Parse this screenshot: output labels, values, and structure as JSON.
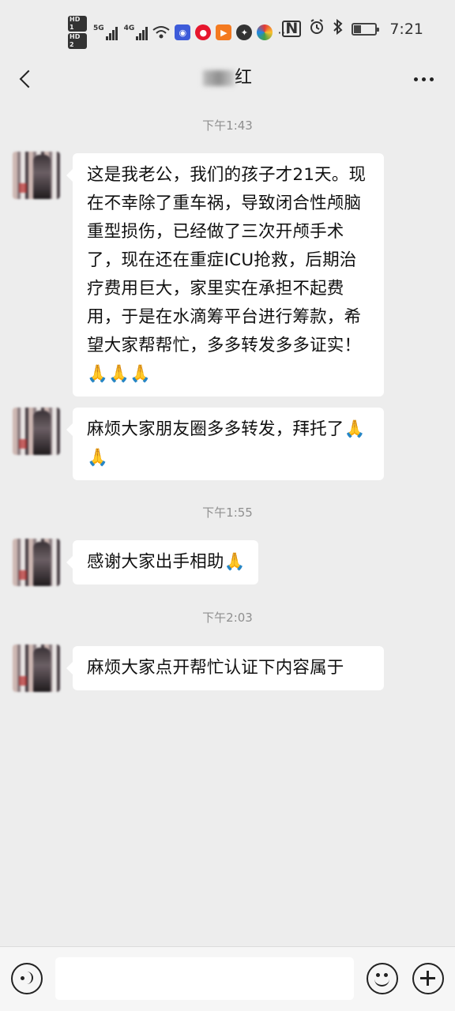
{
  "status_bar": {
    "hd1": "HD 1",
    "hd2": "HD 2",
    "net1": "5G",
    "net2": "4G",
    "wifi_icon": "wifi-icon",
    "app_icons": [
      "blue-app-icon",
      "weibo-icon",
      "video-app-icon",
      "aperture-icon",
      "colorful-app-icon"
    ],
    "more_dots": "···",
    "nfc": "N",
    "alarm_icon": "alarm-icon",
    "bluetooth_icon": "bluetooth-icon",
    "battery_level": 0.3,
    "time": "7:21"
  },
  "header": {
    "title": "红"
  },
  "messages": [
    {
      "time": "下午1:43",
      "text": "这是我老公，我们的孩子才21天。现在不幸除了重车祸，导致闭合性颅脑重型损伤，已经做了三次开颅手术了，现在还在重症ICU抢救，后期治疗费用巨大，家里实在承担不起费用，于是在水滴筹平台进行筹款，希望大家帮帮忙，多多转发多多证实！🙏🙏🙏"
    },
    {
      "text": "麻烦大家朋友圈多多转发，拜托了🙏🙏"
    },
    {
      "time": "下午1:55",
      "text": "感谢大家出手相助🙏"
    },
    {
      "time": "下午2:03",
      "text": "麻烦大家点开帮忙认证下内容属于"
    }
  ],
  "colors": {
    "background": "#ededed",
    "bubble": "#ffffff",
    "timestamp": "#8f8f8f"
  }
}
